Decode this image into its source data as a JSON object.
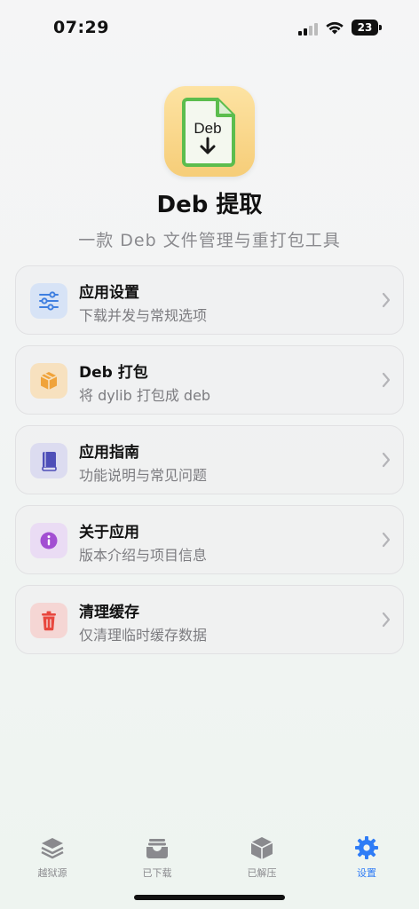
{
  "status_bar": {
    "time": "07:29",
    "battery": "23"
  },
  "header": {
    "title": "Deb 提取",
    "subtitle": "一款 Deb 文件管理与重打包工具",
    "icon_label": "Deb"
  },
  "menu": [
    {
      "title": "应用设置",
      "subtitle": "下载并发与常规选项",
      "icon": "sliders-icon",
      "color": "#3f7fe0"
    },
    {
      "title": "Deb 打包",
      "subtitle": "将 dylib 打包成  deb",
      "icon": "package-box-icon",
      "color": "#f0a33a"
    },
    {
      "title": "应用指南",
      "subtitle": "功能说明与常见问题",
      "icon": "book-icon",
      "color": "#4e4fb8"
    },
    {
      "title": "关于应用",
      "subtitle": "版本介绍与项目信息",
      "icon": "info-icon",
      "color": "#a24fd2"
    },
    {
      "title": "清理缓存",
      "subtitle": "仅清理临时缓存数据",
      "icon": "trash-icon",
      "color": "#e8473e"
    }
  ],
  "tabs": [
    {
      "label": "越狱源",
      "icon": "layers-icon",
      "active": false
    },
    {
      "label": "已下载",
      "icon": "tray-icon",
      "active": false
    },
    {
      "label": "已解压",
      "icon": "cube-icon",
      "active": false
    },
    {
      "label": "设置",
      "icon": "gear-icon",
      "active": true
    }
  ],
  "colors": {
    "accent": "#2f7cf6",
    "tab_inactive": "#8a8a8e",
    "icon_bg": "#f6cd78",
    "icon_doc": "#5cbd4e"
  }
}
